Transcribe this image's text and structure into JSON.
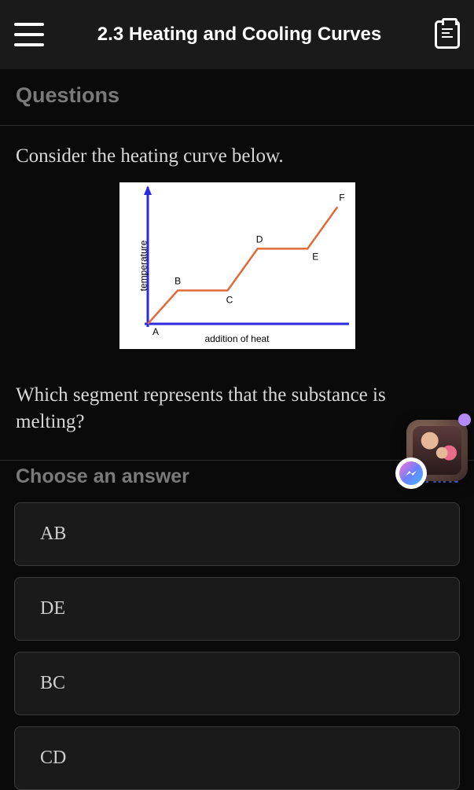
{
  "header": {
    "title": "2.3 Heating and Cooling Curves"
  },
  "section_title": "Questions",
  "question": {
    "prompt": "Consider the heating curve below.",
    "sub_prompt": "Which segment represents that the substance is melting?"
  },
  "chart_data": {
    "type": "line",
    "xlabel": "addition of heat",
    "ylabel": "temperature",
    "points": [
      {
        "label": "A",
        "x": 0,
        "y": 0
      },
      {
        "label": "B",
        "x": 15,
        "y": 20
      },
      {
        "label": "C",
        "x": 40,
        "y": 20
      },
      {
        "label": "D",
        "x": 55,
        "y": 45
      },
      {
        "label": "E",
        "x": 80,
        "y": 45
      },
      {
        "label": "F",
        "x": 95,
        "y": 70
      }
    ],
    "line_color": "#e06a3a",
    "axis_color": "#2a2ae0"
  },
  "answer_section": {
    "label": "Choose an answer",
    "hint_label": "Hint",
    "options": [
      "AB",
      "DE",
      "BC",
      "CD"
    ]
  }
}
